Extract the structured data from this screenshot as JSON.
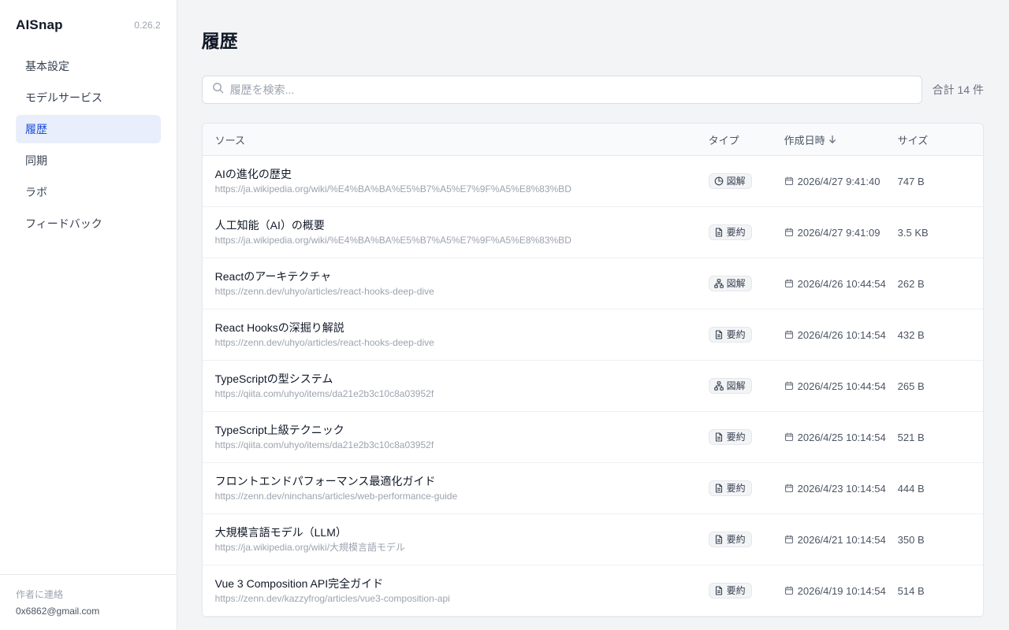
{
  "app": {
    "name": "AISnap",
    "version": "0.26.2"
  },
  "sidebar": {
    "items": [
      {
        "label": "基本設定"
      },
      {
        "label": "モデルサービス"
      },
      {
        "label": "履歴"
      },
      {
        "label": "同期"
      },
      {
        "label": "ラボ"
      },
      {
        "label": "フィードバック"
      }
    ],
    "active_index": 2,
    "footer": {
      "label": "作者に連絡",
      "email": "0x6862@gmail.com"
    }
  },
  "main": {
    "title": "履歴",
    "search": {
      "placeholder": "履歴を検索...",
      "value": ""
    },
    "total": "合計 14 件"
  },
  "table": {
    "columns": {
      "source": "ソース",
      "type": "タイプ",
      "date": "作成日時",
      "size": "サイズ"
    },
    "rows": [
      {
        "title": "AIの進化の歴史",
        "url": "https://ja.wikipedia.org/wiki/%E4%BA%BA%E5%B7%A5%E7%9F%A5%E8%83%BD",
        "type": "図解",
        "type_icon": "clock-pie-icon",
        "date": "2026/4/27 9:41:40",
        "size": "747 B"
      },
      {
        "title": "人工知能（AI）の概要",
        "url": "https://ja.wikipedia.org/wiki/%E4%BA%BA%E5%B7%A5%E7%9F%A5%E8%83%BD",
        "type": "要約",
        "type_icon": "document-icon",
        "date": "2026/4/27 9:41:09",
        "size": "3.5 KB"
      },
      {
        "title": "Reactのアーキテクチャ",
        "url": "https://zenn.dev/uhyo/articles/react-hooks-deep-dive",
        "type": "図解",
        "type_icon": "network-icon",
        "date": "2026/4/26 10:44:54",
        "size": "262 B"
      },
      {
        "title": "React Hooksの深掘り解説",
        "url": "https://zenn.dev/uhyo/articles/react-hooks-deep-dive",
        "type": "要約",
        "type_icon": "document-icon",
        "date": "2026/4/26 10:14:54",
        "size": "432 B"
      },
      {
        "title": "TypeScriptの型システム",
        "url": "https://qiita.com/uhyo/items/da21e2b3c10c8a03952f",
        "type": "図解",
        "type_icon": "network-icon",
        "date": "2026/4/25 10:44:54",
        "size": "265 B"
      },
      {
        "title": "TypeScript上級テクニック",
        "url": "https://qiita.com/uhyo/items/da21e2b3c10c8a03952f",
        "type": "要約",
        "type_icon": "document-icon",
        "date": "2026/4/25 10:14:54",
        "size": "521 B"
      },
      {
        "title": "フロントエンドパフォーマンス最適化ガイド",
        "url": "https://zenn.dev/ninchans/articles/web-performance-guide",
        "type": "要約",
        "type_icon": "document-icon",
        "date": "2026/4/23 10:14:54",
        "size": "444 B"
      },
      {
        "title": "大規模言語モデル（LLM）",
        "url": "https://ja.wikipedia.org/wiki/大規模言語モデル",
        "type": "要約",
        "type_icon": "document-icon",
        "date": "2026/4/21 10:14:54",
        "size": "350 B"
      },
      {
        "title": "Vue 3 Composition API完全ガイド",
        "url": "https://zenn.dev/kazzyfrog/articles/vue3-composition-api",
        "type": "要約",
        "type_icon": "document-icon",
        "date": "2026/4/19 10:14:54",
        "size": "514 B"
      }
    ]
  },
  "colors": {
    "accent": "#1d4ed8",
    "accent_bg": "#e8eefb"
  }
}
